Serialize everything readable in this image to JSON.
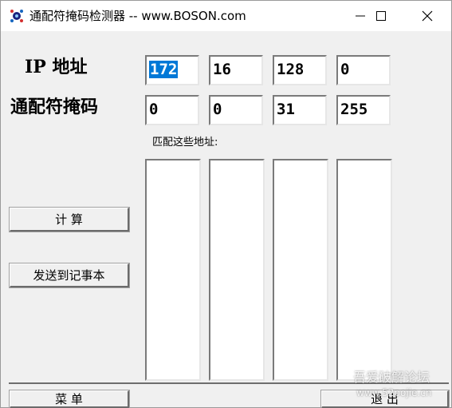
{
  "window": {
    "title": "通配符掩码检测器  -- www.BOSON.com",
    "minimize_icon": "minimize-icon",
    "maximize_icon": "maximize-icon",
    "close_icon": "close-icon"
  },
  "labels": {
    "ip_address": "IP 地址",
    "wildcard_mask": "通配符掩码",
    "matching_addresses": "匹配这些地址:"
  },
  "ip_octets": [
    "172",
    "16",
    "128",
    "0"
  ],
  "mask_octets": [
    "0",
    "0",
    "31",
    "255"
  ],
  "buttons": {
    "calculate": "计    算",
    "send_to_notepad": "发送到记事本",
    "menu": "菜  单",
    "exit": "退  出"
  },
  "watermark": {
    "line1": "吾爱破解论坛",
    "line2": "www.52pojie.cn"
  },
  "colors": {
    "selection": "#0078d7",
    "window_bg": "#f0f0f0"
  }
}
